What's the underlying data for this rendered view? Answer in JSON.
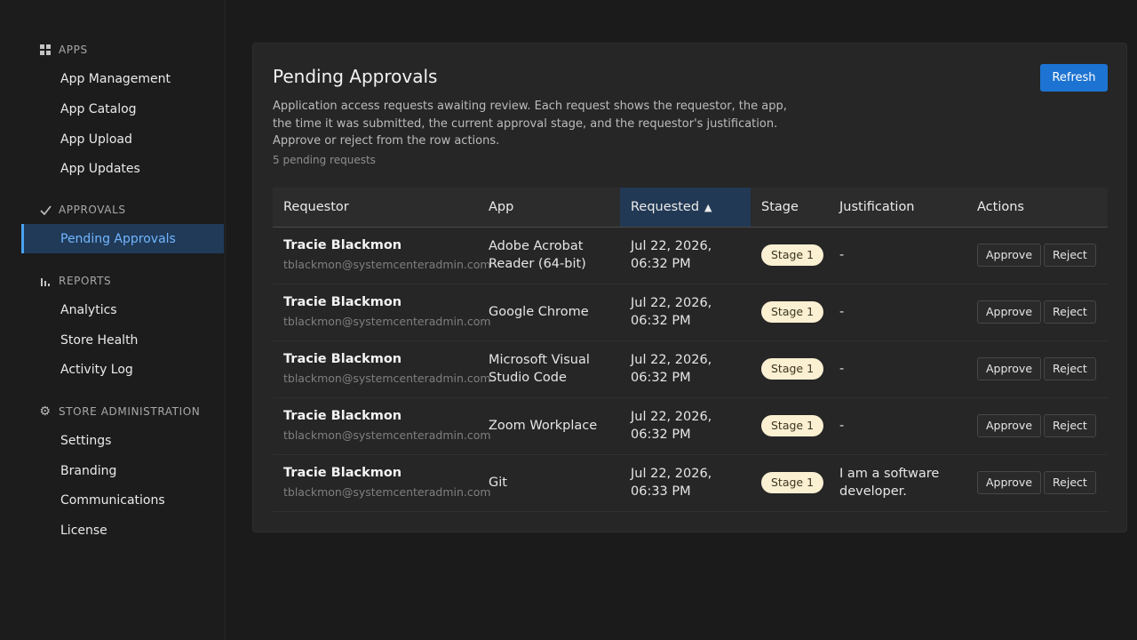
{
  "sidebar": {
    "sections": [
      {
        "title": "APPS",
        "icon": "grid-icon",
        "items": [
          "App Management",
          "App Catalog",
          "App Upload",
          "App Updates"
        ]
      },
      {
        "title": "APPROVALS",
        "icon": "check-icon",
        "items": [
          "Pending Approvals"
        ]
      },
      {
        "title": "REPORTS",
        "icon": "bar-chart-icon",
        "items": [
          "Analytics",
          "Store Health",
          "Activity Log"
        ]
      },
      {
        "title": "STORE ADMINISTRATION",
        "icon": "gear-icon",
        "items": [
          "Settings",
          "Branding",
          "Communications",
          "License"
        ]
      }
    ],
    "active_item": "Pending Approvals"
  },
  "main": {
    "title": "Pending Approvals",
    "refresh_label": "Refresh",
    "description": "Application access requests awaiting review. Each request shows the requestor, the app, the time it was submitted, the current approval stage, and the requestor's justification. Approve or reject from the row actions.",
    "count_text": "5 pending requests",
    "columns": [
      "Requestor",
      "App",
      "Requested",
      "Stage",
      "Justification",
      "Actions"
    ],
    "sort_indicator": "▲",
    "approve_label": "Approve",
    "reject_label": "Reject",
    "rows": [
      {
        "name": "Tracie Blackmon",
        "email": "tblackmon@systemcenteradmin.com",
        "app": "Adobe Acrobat Reader (64-bit)",
        "requested": "Jul 22, 2026, 06:32 PM",
        "stage": "Stage 1",
        "justification": "-"
      },
      {
        "name": "Tracie Blackmon",
        "email": "tblackmon@systemcenteradmin.com",
        "app": "Google Chrome",
        "requested": "Jul 22, 2026, 06:32 PM",
        "stage": "Stage 1",
        "justification": "-"
      },
      {
        "name": "Tracie Blackmon",
        "email": "tblackmon@systemcenteradmin.com",
        "app": "Microsoft Visual Studio Code",
        "requested": "Jul 22, 2026, 06:32 PM",
        "stage": "Stage 1",
        "justification": "-"
      },
      {
        "name": "Tracie Blackmon",
        "email": "tblackmon@systemcenteradmin.com",
        "app": "Zoom Workplace",
        "requested": "Jul 22, 2026, 06:32 PM",
        "stage": "Stage 1",
        "justification": "-"
      },
      {
        "name": "Tracie Blackmon",
        "email": "tblackmon@systemcenteradmin.com",
        "app": "Git",
        "requested": "Jul 22, 2026, 06:33 PM",
        "stage": "Stage 1",
        "justification": "I am a software developer."
      }
    ]
  },
  "colors": {
    "accent": "#1d73d1",
    "active_nav_bg": "#203a58",
    "active_nav_text": "#72b6ff",
    "stage_badge_bg": "#fbf0d2"
  }
}
